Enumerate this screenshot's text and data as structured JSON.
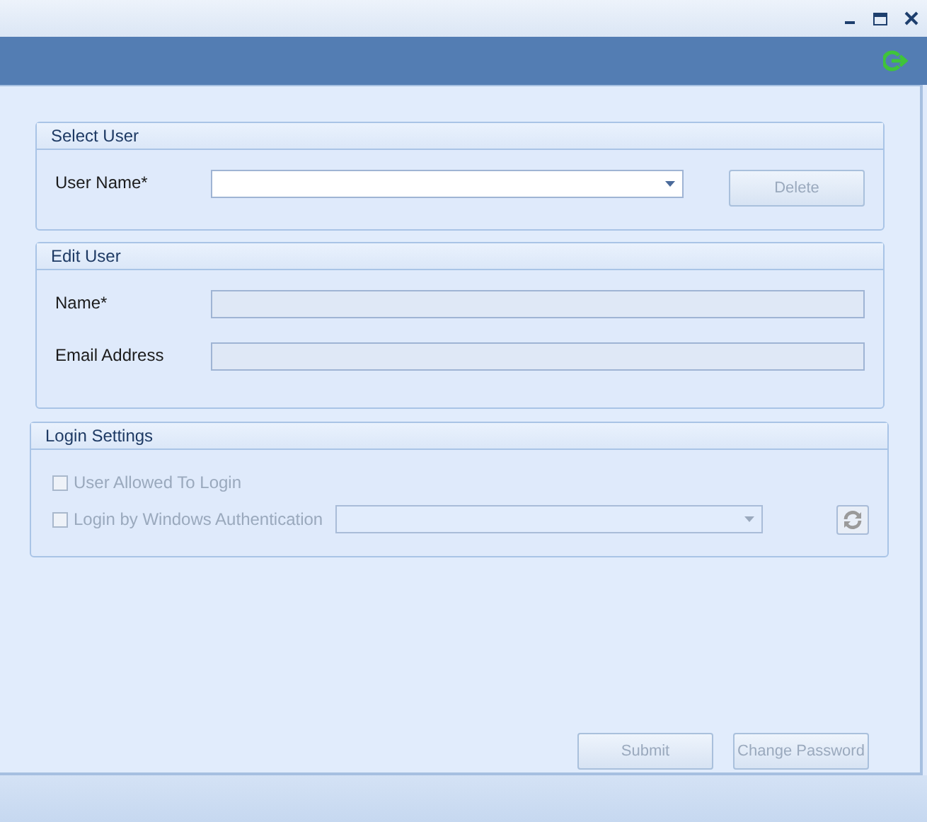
{
  "window": {
    "controls": [
      {
        "kind": "minimize"
      },
      {
        "kind": "maximize"
      },
      {
        "kind": "close"
      }
    ]
  },
  "select_user": {
    "title": "Select User",
    "user_name": {
      "label": "User Name*",
      "disabled": false
    },
    "delete_button": {
      "label": "Delete",
      "disabled": true
    }
  },
  "edit_user": {
    "title": "Edit User",
    "fields": [
      {
        "label": "Name*",
        "disabled": true
      },
      {
        "label": "Email Address",
        "disabled": true
      }
    ]
  },
  "login_settings": {
    "title": "Login Settings",
    "options": [
      {
        "label": "User Allowed To Login",
        "checked": false,
        "disabled": true
      },
      {
        "label": "Login by Windows Authentication",
        "checked": false,
        "disabled": true
      }
    ],
    "domain_select": {
      "disabled": true
    },
    "refresh_button": {
      "disabled": true
    }
  },
  "buttons": [
    {
      "label": "Submit",
      "disabled": true
    },
    {
      "label": "Change Password",
      "disabled": true
    }
  ]
}
